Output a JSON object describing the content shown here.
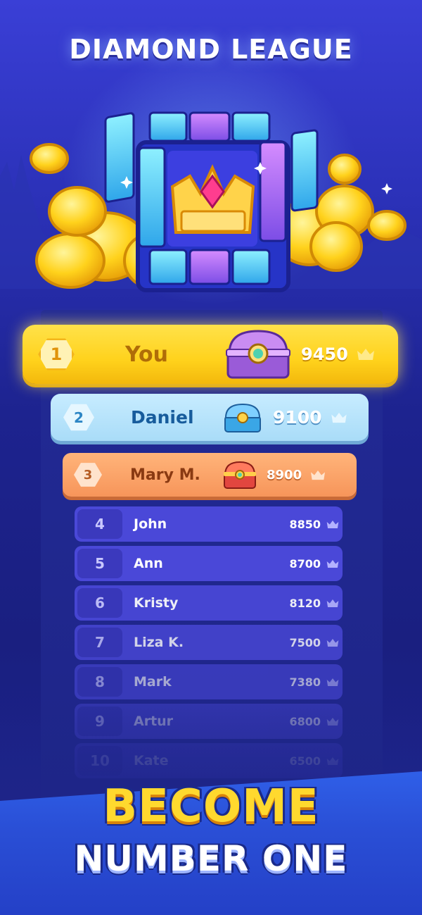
{
  "league": {
    "title": "DIAMOND LEAGUE"
  },
  "top_players": [
    {
      "rank": "1",
      "name": "You",
      "score": "9450"
    },
    {
      "rank": "2",
      "name": "Daniel",
      "score": "9100"
    },
    {
      "rank": "3",
      "name": "Mary M.",
      "score": "8900"
    }
  ],
  "players": [
    {
      "rank": "4",
      "name": "John",
      "score": "8850",
      "opacity": 1.0
    },
    {
      "rank": "5",
      "name": "Ann",
      "score": "8700",
      "opacity": 1.0
    },
    {
      "rank": "6",
      "name": "Kristy",
      "score": "8120",
      "opacity": 0.92
    },
    {
      "rank": "7",
      "name": "Liza K.",
      "score": "7500",
      "opacity": 0.8
    },
    {
      "rank": "8",
      "name": "Mark",
      "score": "7380",
      "opacity": 0.6
    },
    {
      "rank": "9",
      "name": "Artur",
      "score": "6800",
      "opacity": 0.42
    },
    {
      "rank": "10",
      "name": "Kate",
      "score": "6500",
      "opacity": 0.28
    }
  ],
  "promo": {
    "line1": "BECOME",
    "line2": "NUMBER ONE"
  },
  "colors": {
    "gold": "#ffd21c",
    "silver": "#a9dcf8",
    "bronze": "#f7955a",
    "row": "#4a48d8"
  },
  "icons": [
    "crown-icon",
    "chest-icon",
    "crown-emblem",
    "gold-coin"
  ]
}
